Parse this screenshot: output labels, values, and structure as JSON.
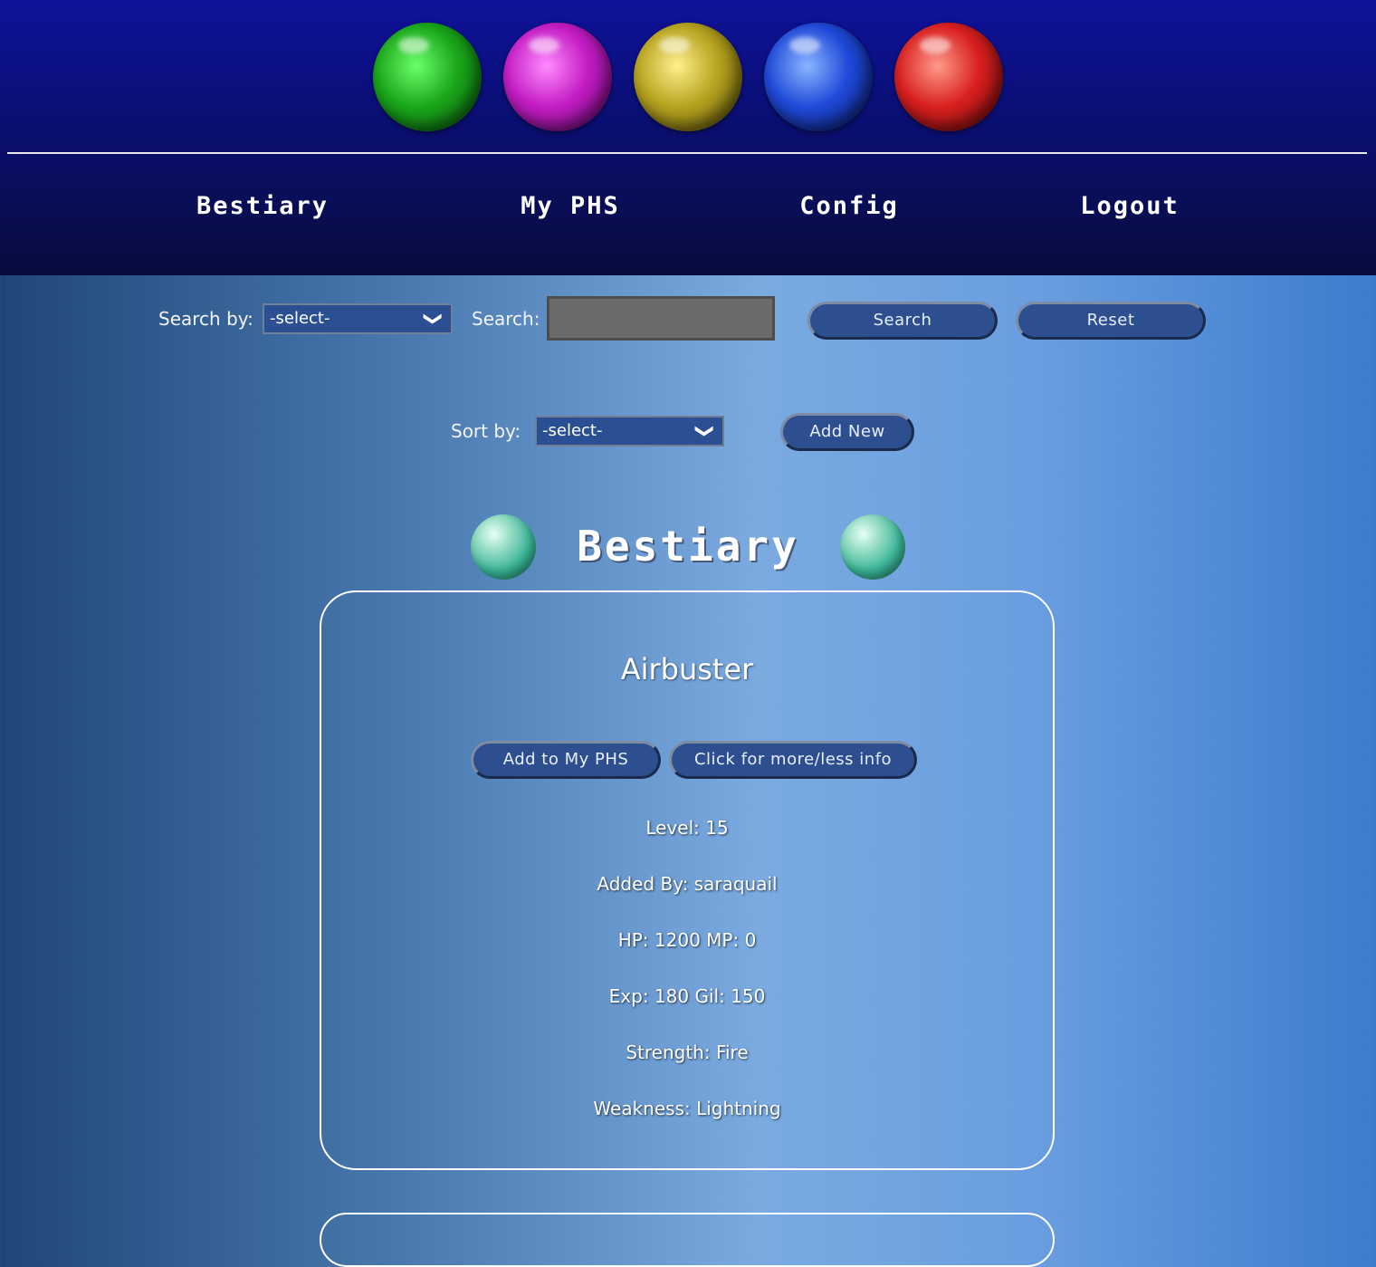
{
  "header": {
    "orbs": [
      {
        "name": "green-orb-icon",
        "color": "#1aa61a"
      },
      {
        "name": "magenta-orb-icon",
        "color": "#c31cc3"
      },
      {
        "name": "yellow-orb-icon",
        "color": "#b5a21f"
      },
      {
        "name": "blue-orb-icon",
        "color": "#1f49d8"
      },
      {
        "name": "red-orb-icon",
        "color": "#d81f1f"
      }
    ],
    "nav": [
      {
        "label": "Bestiary"
      },
      {
        "label": "My PHS"
      },
      {
        "label": "Config"
      },
      {
        "label": "Logout"
      }
    ]
  },
  "search": {
    "by_label": "Search by:",
    "by_selected": "-select-",
    "search_label": "Search:",
    "search_value": "",
    "search_button": "Search",
    "reset_button": "Reset"
  },
  "sort": {
    "label": "Sort by:",
    "selected": "-select-",
    "add_new_button": "Add New"
  },
  "page": {
    "title": "Bestiary"
  },
  "card": {
    "name": "Airbuster",
    "add_button": "Add to My PHS",
    "info_button": "Click for more/less info",
    "level": "Level: 15",
    "added_by": "Added By: saraquail",
    "hp_mp": "HP: 1200 MP: 0",
    "exp_gil": "Exp: 180 Gil: 150",
    "strength": "Strength: Fire",
    "weakness": "Weakness: Lightning"
  },
  "icons": {
    "chevron": "❯"
  }
}
